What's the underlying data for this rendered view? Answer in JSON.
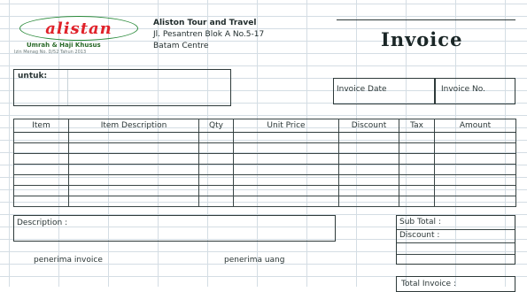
{
  "logo": {
    "wordmark": "alistan",
    "tagline": "Umrah & Haji Khusus",
    "license": "Izin Menag No. D/52 Tahun 2013"
  },
  "company": {
    "name": "Aliston Tour and Travel",
    "address1": "Jl. Pesantren Blok A No.5-17",
    "address2": "Batam Centre"
  },
  "document": {
    "title": "Invoice"
  },
  "recipient": {
    "label": "untuk:"
  },
  "meta": {
    "date_label": "Invoice Date",
    "number_label": "Invoice No."
  },
  "items_table": {
    "columns": [
      "Item",
      "Item Description",
      "Qty",
      "Unit Price",
      "Discount",
      "Tax",
      "Amount"
    ],
    "rows": [
      [
        "",
        "",
        "",
        "",
        "",
        "",
        ""
      ],
      [
        "",
        "",
        "",
        "",
        "",
        "",
        ""
      ],
      [
        "",
        "",
        "",
        "",
        "",
        "",
        ""
      ],
      [
        "",
        "",
        "",
        "",
        "",
        "",
        ""
      ],
      [
        "",
        "",
        "",
        "",
        "",
        "",
        ""
      ],
      [
        "",
        "",
        "",
        "",
        "",
        "",
        ""
      ],
      [
        "",
        "",
        "",
        "",
        "",
        "",
        ""
      ]
    ]
  },
  "description": {
    "label": "Description :"
  },
  "totals": {
    "subtotal_label": "Sub Total :",
    "discount_label": "Discount :",
    "total_label": "Total Invoice :"
  },
  "signatures": {
    "receiver_invoice": "penerima invoice",
    "receiver_money": "penerima uang"
  }
}
